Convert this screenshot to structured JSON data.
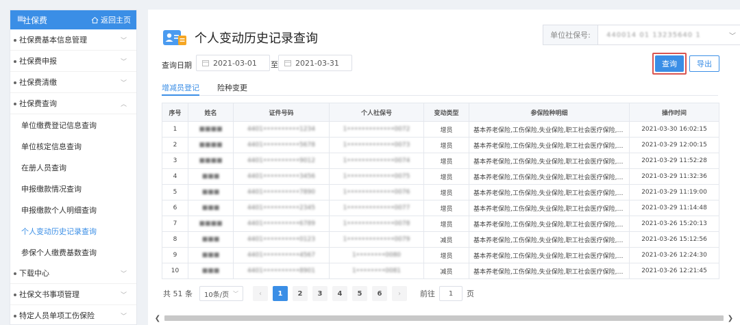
{
  "sidebar": {
    "title": "社保费",
    "home_label": "返回主页",
    "sections": [
      {
        "label": "社保费基本信息管理",
        "chevron": "﹀"
      },
      {
        "label": "社保费申报",
        "chevron": "﹀"
      },
      {
        "label": "社保费清缴",
        "chevron": "﹀"
      },
      {
        "label": "社保费查询",
        "chevron": "︿"
      }
    ],
    "sub_items": [
      "单位缴费登记信息查询",
      "单位核定信息查询",
      "在册人员查询",
      "申报缴款情况查询",
      "申报缴款个人明细查询",
      "个人变动历史记录查询",
      "参保个人缴费基数查询"
    ],
    "active_sub_index": 5,
    "bottom_sections": [
      {
        "label": "下载中心",
        "chevron": "﹀"
      },
      {
        "label": "社保文书事项管理",
        "chevron": "﹀"
      },
      {
        "label": "特定人员单项工伤保险",
        "chevron": "﹀"
      }
    ]
  },
  "page": {
    "title": "个人变动历史记录查询",
    "unit_label": "单位社保号:",
    "unit_value": "440014 01 13235640 1",
    "date_label": "查询日期",
    "date_from": "2021-03-01",
    "date_sep": "至",
    "date_to": "2021-03-31",
    "query_button": "查询",
    "export_button": "导出",
    "tabs": [
      "增减员登记",
      "险种变更"
    ],
    "active_tab": 0
  },
  "table": {
    "headers": [
      "序号",
      "姓名",
      "证件号码",
      "个人社保号",
      "变动类型",
      "参保险种明细",
      "操作时间"
    ],
    "rows": [
      {
        "no": "1",
        "name": "■■■■",
        "id": "4401••••••••••1234",
        "ss": "1•••••••••••••0072",
        "type": "增员",
        "detail": "基本养老保险,工伤保险,失业保险,职工社会医疗保险,职...",
        "time": "2021-03-30 16:02:15"
      },
      {
        "no": "2",
        "name": "■■■■",
        "id": "4401••••••••••5678",
        "ss": "1•••••••••••••0073",
        "type": "增员",
        "detail": "基本养老保险,工伤保险,失业保险,职工社会医疗保险,职...",
        "time": "2021-03-29 12:00:15"
      },
      {
        "no": "3",
        "name": "■■■■",
        "id": "4401••••••••••9012",
        "ss": "1•••••••••••••0074",
        "type": "增员",
        "detail": "基本养老保险,工伤保险,失业保险,职工社会医疗保险,职...",
        "time": "2021-03-29 11:52:28"
      },
      {
        "no": "4",
        "name": "■■■",
        "id": "4401••••••••••3456",
        "ss": "1•••••••••••••0075",
        "type": "增员",
        "detail": "基本养老保险,工伤保险,失业保险,职工社会医疗保险,职...",
        "time": "2021-03-29 11:32:36"
      },
      {
        "no": "5",
        "name": "■■■",
        "id": "4401••••••••••7890",
        "ss": "1•••••••••••••0076",
        "type": "增员",
        "detail": "基本养老保险,工伤保险,失业保险,职工社会医疗保险,职...",
        "time": "2021-03-29 11:19:00"
      },
      {
        "no": "6",
        "name": "■■■",
        "id": "4401••••••••••2345",
        "ss": "1•••••••••••••0077",
        "type": "增员",
        "detail": "基本养老保险,工伤保险,失业保险,职工社会医疗保险,职...",
        "time": "2021-03-29 11:14:48"
      },
      {
        "no": "7",
        "name": "■■■■",
        "id": "4401••••••••••6789",
        "ss": "1•••••••••••••0078",
        "type": "增员",
        "detail": "基本养老保险,工伤保险,失业保险,职工社会医疗保险,职...",
        "time": "2021-03-26 15:20:13"
      },
      {
        "no": "8",
        "name": "■■■",
        "id": "4401••••••••••0123",
        "ss": "1•••••••••••••0079",
        "type": "减员",
        "detail": "基本养老保险,工伤保险,失业保险,职工社会医疗保险,职...",
        "time": "2021-03-26 15:12:56"
      },
      {
        "no": "9",
        "name": "■■■",
        "id": "4401••••••••••4567",
        "ss": "1••••••••0080",
        "type": "增员",
        "detail": "基本养老保险,工伤保险,失业保险,职工社会医疗保险,职...",
        "time": "2021-03-26 12:24:30"
      },
      {
        "no": "10",
        "name": "■■■",
        "id": "4401••••••••••8901",
        "ss": "1••••••••0081",
        "type": "减员",
        "detail": "基本养老保险,工伤保险,失业保险,职工社会医疗保险,职...",
        "time": "2021-03-26 12:21:45"
      }
    ]
  },
  "pager": {
    "total": "共 51 条",
    "page_size": "10条/页",
    "pages": [
      "1",
      "2",
      "3",
      "4",
      "5",
      "6"
    ],
    "current_page": "1",
    "goto_prefix": "前往",
    "goto_value": "1",
    "goto_suffix": "页"
  },
  "colors": {
    "accent": "#3a8ee6",
    "highlight_border": "#d9534f"
  }
}
